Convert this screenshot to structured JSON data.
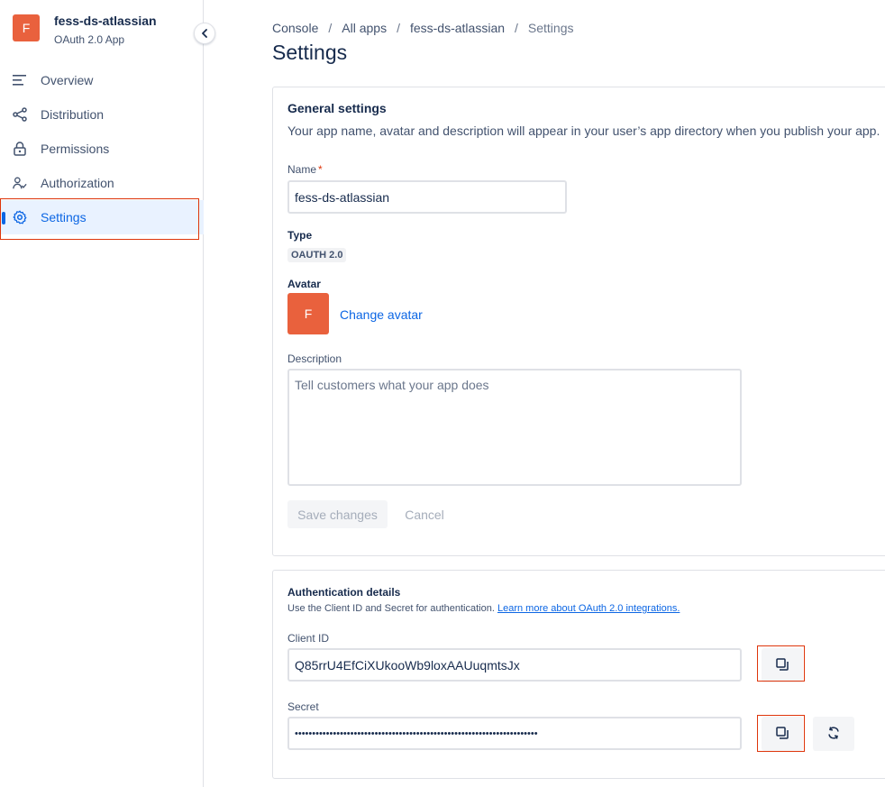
{
  "sidebar": {
    "app_initial": "F",
    "app_name": "fess-ds-atlassian",
    "app_type": "OAuth 2.0 App",
    "items": [
      {
        "label": "Overview",
        "icon": "list-icon"
      },
      {
        "label": "Distribution",
        "icon": "share-icon"
      },
      {
        "label": "Permissions",
        "icon": "lock-icon"
      },
      {
        "label": "Authorization",
        "icon": "person-check-icon"
      },
      {
        "label": "Settings",
        "icon": "gear-icon",
        "active": true
      }
    ]
  },
  "breadcrumb": [
    "Console",
    "All apps",
    "fess-ds-atlassian",
    "Settings"
  ],
  "page_title": "Settings",
  "general": {
    "title": "General settings",
    "description": "Your app name, avatar and description will appear in your user’s app directory when you publish your app.",
    "name_label": "Name",
    "required_marker": "*",
    "name_value": "fess-ds-atlassian",
    "type_label": "Type",
    "type_value": "OAUTH 2.0",
    "avatar_label": "Avatar",
    "avatar_initial": "F",
    "change_avatar": "Change avatar",
    "description_label": "Description",
    "description_placeholder": "Tell customers what your app does",
    "save_label": "Save changes",
    "cancel_label": "Cancel"
  },
  "auth": {
    "title": "Authentication details",
    "description": "Use the Client ID and Secret for authentication.",
    "learn_more": "Learn more about OAuth 2.0 integrations.",
    "client_id_label": "Client ID",
    "client_id_value": "Q85rrU4EfCiXUkooWb9loxAAUuqmtsJx",
    "secret_label": "Secret",
    "secret_value": "••••••••••••••••••••••••••••••••••••••••••••••••••••••••••••••••••••••"
  },
  "colors": {
    "accent": "#0c66e4",
    "avatar": "#e9613d",
    "highlight": "#de350b"
  }
}
